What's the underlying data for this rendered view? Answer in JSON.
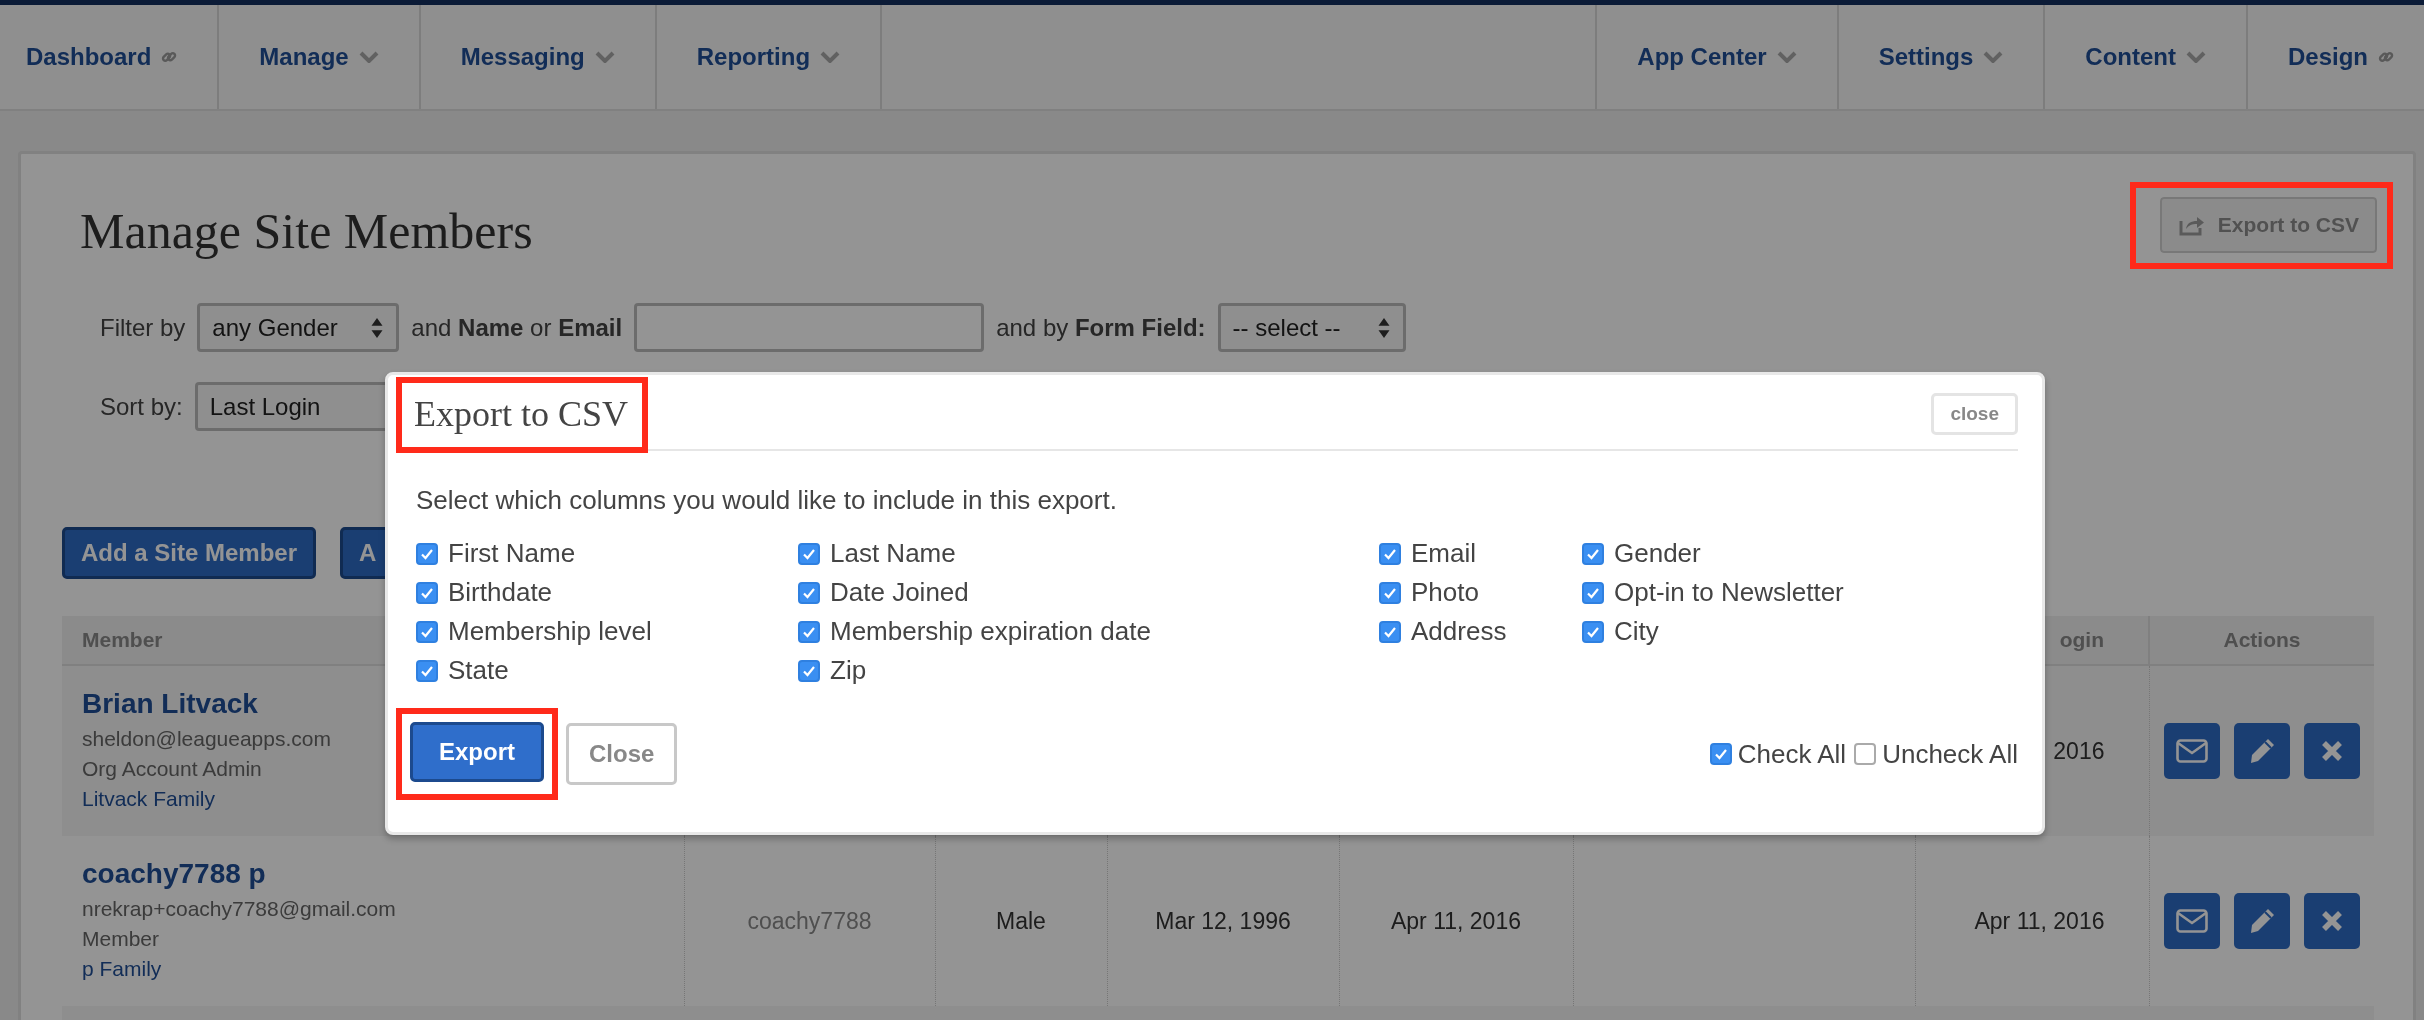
{
  "nav": {
    "left": [
      {
        "label": "Dashboard",
        "kind": "link"
      },
      {
        "label": "Manage",
        "kind": "menu"
      },
      {
        "label": "Messaging",
        "kind": "menu"
      },
      {
        "label": "Reporting",
        "kind": "menu"
      }
    ],
    "right": [
      {
        "label": "App Center",
        "kind": "menu"
      },
      {
        "label": "Settings",
        "kind": "menu"
      },
      {
        "label": "Content",
        "kind": "menu"
      },
      {
        "label": "Design",
        "kind": "link"
      }
    ]
  },
  "page": {
    "title": "Manage Site Members",
    "export_button": {
      "label": "Export to CSV",
      "highlighted": true
    },
    "filter": {
      "prefix": "Filter by",
      "gender_select": "any Gender",
      "name_email_label": "and **Name** or **Email**",
      "form_field_label": "and by **Form Field:**",
      "form_field_select": "-- select --"
    },
    "sort": {
      "label": "Sort by:",
      "select": "Last Login"
    },
    "buttons": [
      "Add a Site Member",
      "A"
    ],
    "table": {
      "headers": {
        "member": "Member",
        "column_7": "ogin",
        "actions": "Actions"
      },
      "rows": [
        {
          "name": "Brian Litvack",
          "email": "sheldon@leagueapps.com",
          "role": "Org Account Admin",
          "family": "Litvack Family",
          "column_7": "2016"
        },
        {
          "name": "coachy7788 p",
          "email": "nrekrap+coachy7788@gmail.com",
          "role": "Member",
          "family": "p Family",
          "column_2": "coachy7788",
          "column_3": "Male",
          "column_4": "Mar 12, 1996",
          "column_5": "Apr 11, 2016",
          "column_7": "Apr 11, 2016"
        }
      ]
    }
  },
  "modal": {
    "title": "Export to CSV",
    "title_highlighted": true,
    "close": "close",
    "description": "Select which columns you would like to include in this export.",
    "columns": [
      {
        "label": "First Name",
        "checked": true
      },
      {
        "label": "Last Name",
        "checked": true
      },
      {
        "label": "Email",
        "checked": true
      },
      {
        "label": "Gender",
        "checked": true
      },
      {
        "label": "Birthdate",
        "checked": true
      },
      {
        "label": "Date Joined",
        "checked": true
      },
      {
        "label": "Photo",
        "checked": true
      },
      {
        "label": "Opt-in to Newsletter",
        "checked": true
      },
      {
        "label": "Membership level",
        "checked": true
      },
      {
        "label": "Membership expiration date",
        "checked": true
      },
      {
        "label": "Address",
        "checked": true
      },
      {
        "label": "City",
        "checked": true
      },
      {
        "label": "State",
        "checked": true
      },
      {
        "label": "Zip",
        "checked": true
      }
    ],
    "export": {
      "label": "Export",
      "highlighted": true
    },
    "close_button": "Close",
    "check_all": {
      "label": "Check All",
      "checked": true
    },
    "uncheck_all": {
      "label": "Uncheck All",
      "checked": false
    }
  }
}
